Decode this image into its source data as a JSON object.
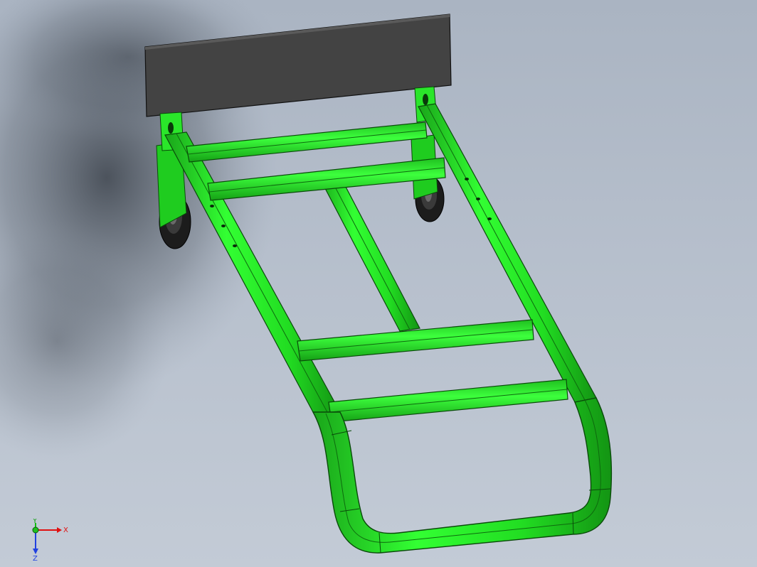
{
  "viewport": {
    "background_top": "#aab4c2",
    "background_bottom": "#c3cbd6"
  },
  "model": {
    "frame_color": "#22ee22",
    "frame_dark": "#14a814",
    "frame_edge": "#0a4a0a",
    "toe_plate_color": "#4a4a4a",
    "wheel_color": "#222222"
  },
  "triad": {
    "x_label": "X",
    "y_label": "Y",
    "z_label": "Z",
    "x_color": "#e01010",
    "y_color": "#10c010",
    "z_color": "#2040e0"
  }
}
